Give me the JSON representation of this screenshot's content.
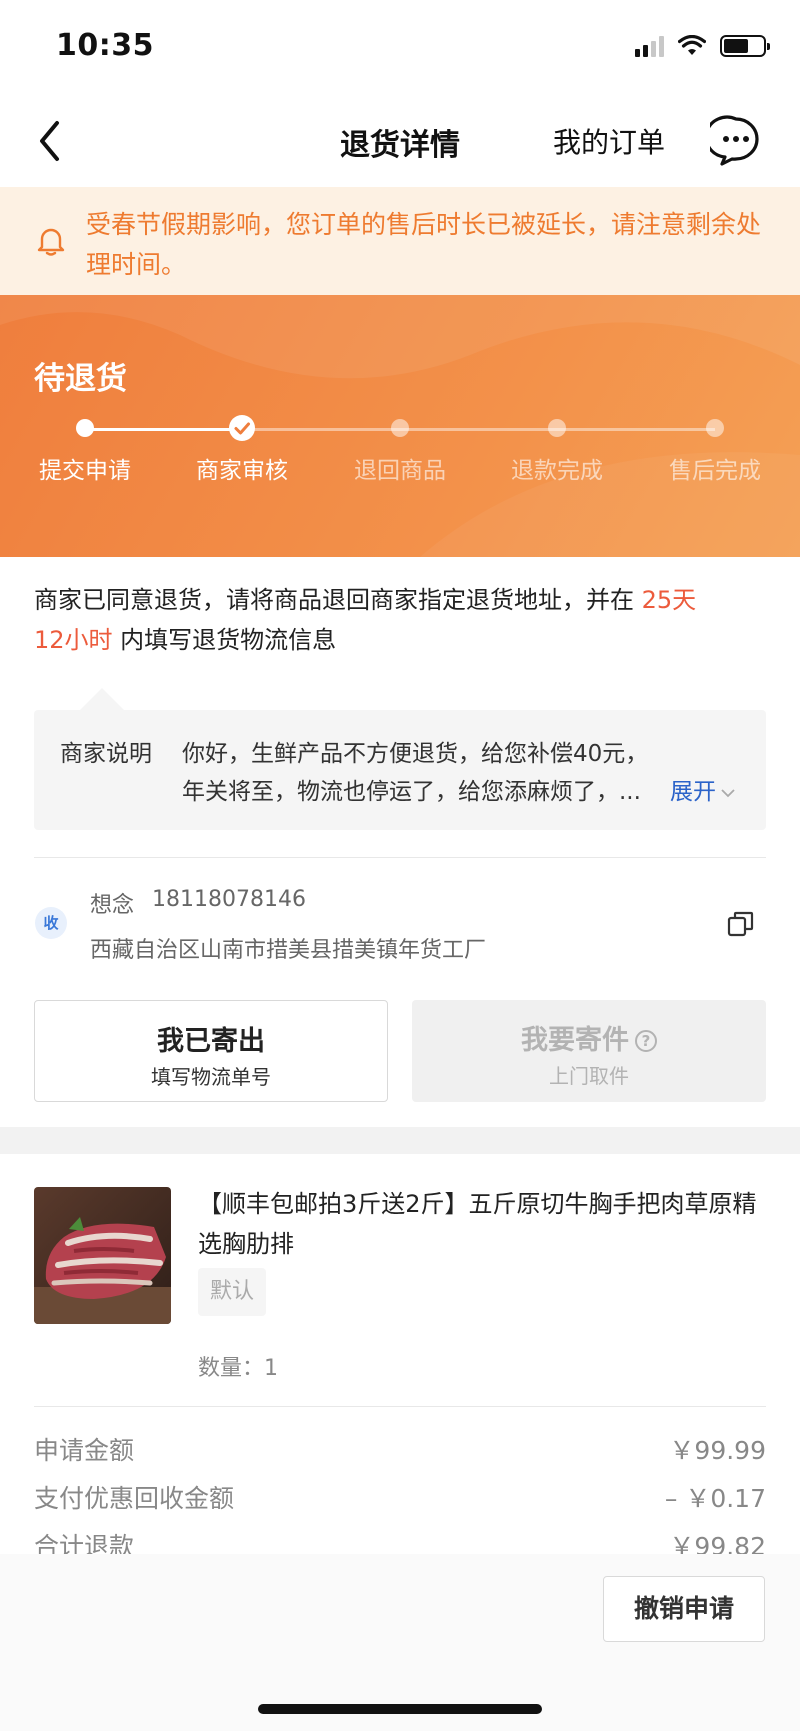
{
  "status_bar": {
    "time": "10:35"
  },
  "nav": {
    "title": "退货详情",
    "my_orders": "我的订单"
  },
  "notice": {
    "text": "受春节假期影响，您订单的售后时长已被延长，请注意剩余处理时间。"
  },
  "progress": {
    "status": "待退货",
    "steps": [
      {
        "label": "提交申请",
        "state": "done"
      },
      {
        "label": "商家审核",
        "state": "current"
      },
      {
        "label": "退回商品",
        "state": "pending"
      },
      {
        "label": "退款完成",
        "state": "pending"
      },
      {
        "label": "售后完成",
        "state": "pending"
      }
    ]
  },
  "instruction": {
    "prefix": "商家已同意退货，请将商品退回商家指定退货地址，并在 ",
    "deadline_days": "25天",
    "deadline_hours": "12小时",
    "suffix": " 内填写退货物流信息"
  },
  "merchant_note": {
    "label": "商家说明",
    "line1": "你好，生鲜产品不方便退货，给您补偿40元，",
    "line2": "年关将至，物流也停运了，给您添麻烦了，...",
    "expand": "展开"
  },
  "address": {
    "icon_text": "收",
    "name": "想念",
    "phone": "18118078146",
    "detail": "西藏自治区山南市措美县措美镇年货工厂"
  },
  "actions": {
    "sent": {
      "title": "我已寄出",
      "subtitle": "填写物流单号"
    },
    "pickup": {
      "title": "我要寄件",
      "subtitle": "上门取件"
    }
  },
  "product": {
    "title": "【顺丰包邮拍3斤送2斤】五斤原切牛胸手把肉草原精选胸肋排",
    "spec": "默认",
    "quantity": "数量：1"
  },
  "amounts": [
    {
      "label": "申请金额",
      "value": "￥99.99"
    },
    {
      "label": "支付优惠回收金额",
      "value": "– ￥0.17"
    },
    {
      "label": "合计退款",
      "value": "￥99.82"
    }
  ],
  "bottom": {
    "cancel": "撤销申请"
  },
  "colors": {
    "accent": "#ef7e3d",
    "notice_text": "#ee7b30",
    "deadline": "#ec5b3c",
    "link": "#2b63c9"
  }
}
